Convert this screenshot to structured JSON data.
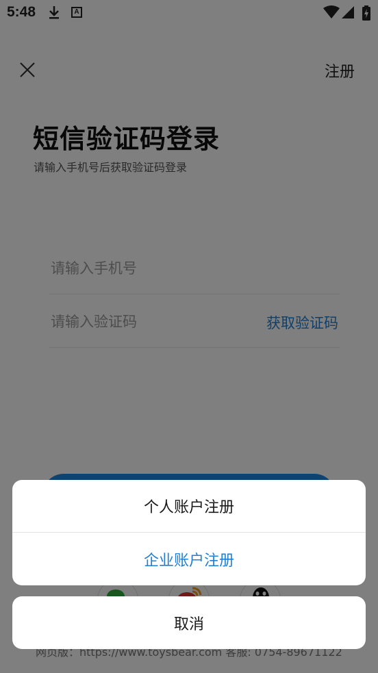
{
  "status_bar": {
    "time": "5:48",
    "icons": [
      "download-icon",
      "a-notification-icon",
      "wifi-icon",
      "signal-icon",
      "battery-charging-icon"
    ],
    "a_icon_text": "A"
  },
  "header": {
    "close_icon": "close-icon",
    "register_label": "注册"
  },
  "login": {
    "title": "短信验证码登录",
    "subtitle": "请输入手机号后获取验证码登录",
    "phone_placeholder": "请输入手机号",
    "code_placeholder": "请输入验证码",
    "get_code_label": "获取验证码"
  },
  "social_login": {
    "icons": [
      "wechat-icon",
      "weibo-icon",
      "qq-icon"
    ]
  },
  "footer": {
    "text": "网页版：https://www.toysbear.com   客服: 0754-89671122"
  },
  "action_sheet": {
    "options": [
      "个人账户注册",
      "企业账户注册"
    ],
    "cancel_label": "取消"
  },
  "colors": {
    "accent": "#1f7fd6",
    "overlay": "rgba(0,0,0,0.5)"
  }
}
